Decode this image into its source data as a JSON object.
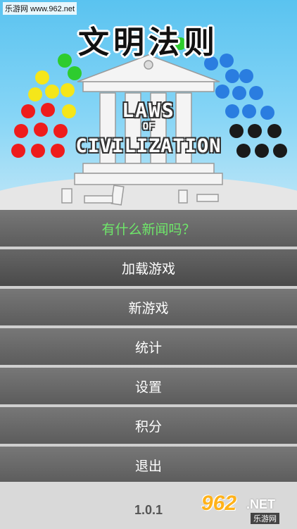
{
  "watermark": {
    "top_text": "乐游网 www.962.net",
    "logo_number": "962",
    "logo_suffix": ".NET",
    "logo_sub": "乐游网"
  },
  "header": {
    "game_title": "文明法则"
  },
  "logo": {
    "line1": "LAWS",
    "line2": "OF",
    "line3": "CIVILIZATION"
  },
  "menu": {
    "items": [
      {
        "label": "有什么新闻吗？"
      },
      {
        "label": "加载游戏"
      },
      {
        "label": "新游戏"
      },
      {
        "label": "统计"
      },
      {
        "label": "设置"
      },
      {
        "label": "积分"
      },
      {
        "label": "退出"
      }
    ]
  },
  "footer": {
    "version": "1.0.1"
  },
  "colors": {
    "news": "#6fe86a",
    "menu_bg": "#666666",
    "sky": "#5ac3f0"
  }
}
